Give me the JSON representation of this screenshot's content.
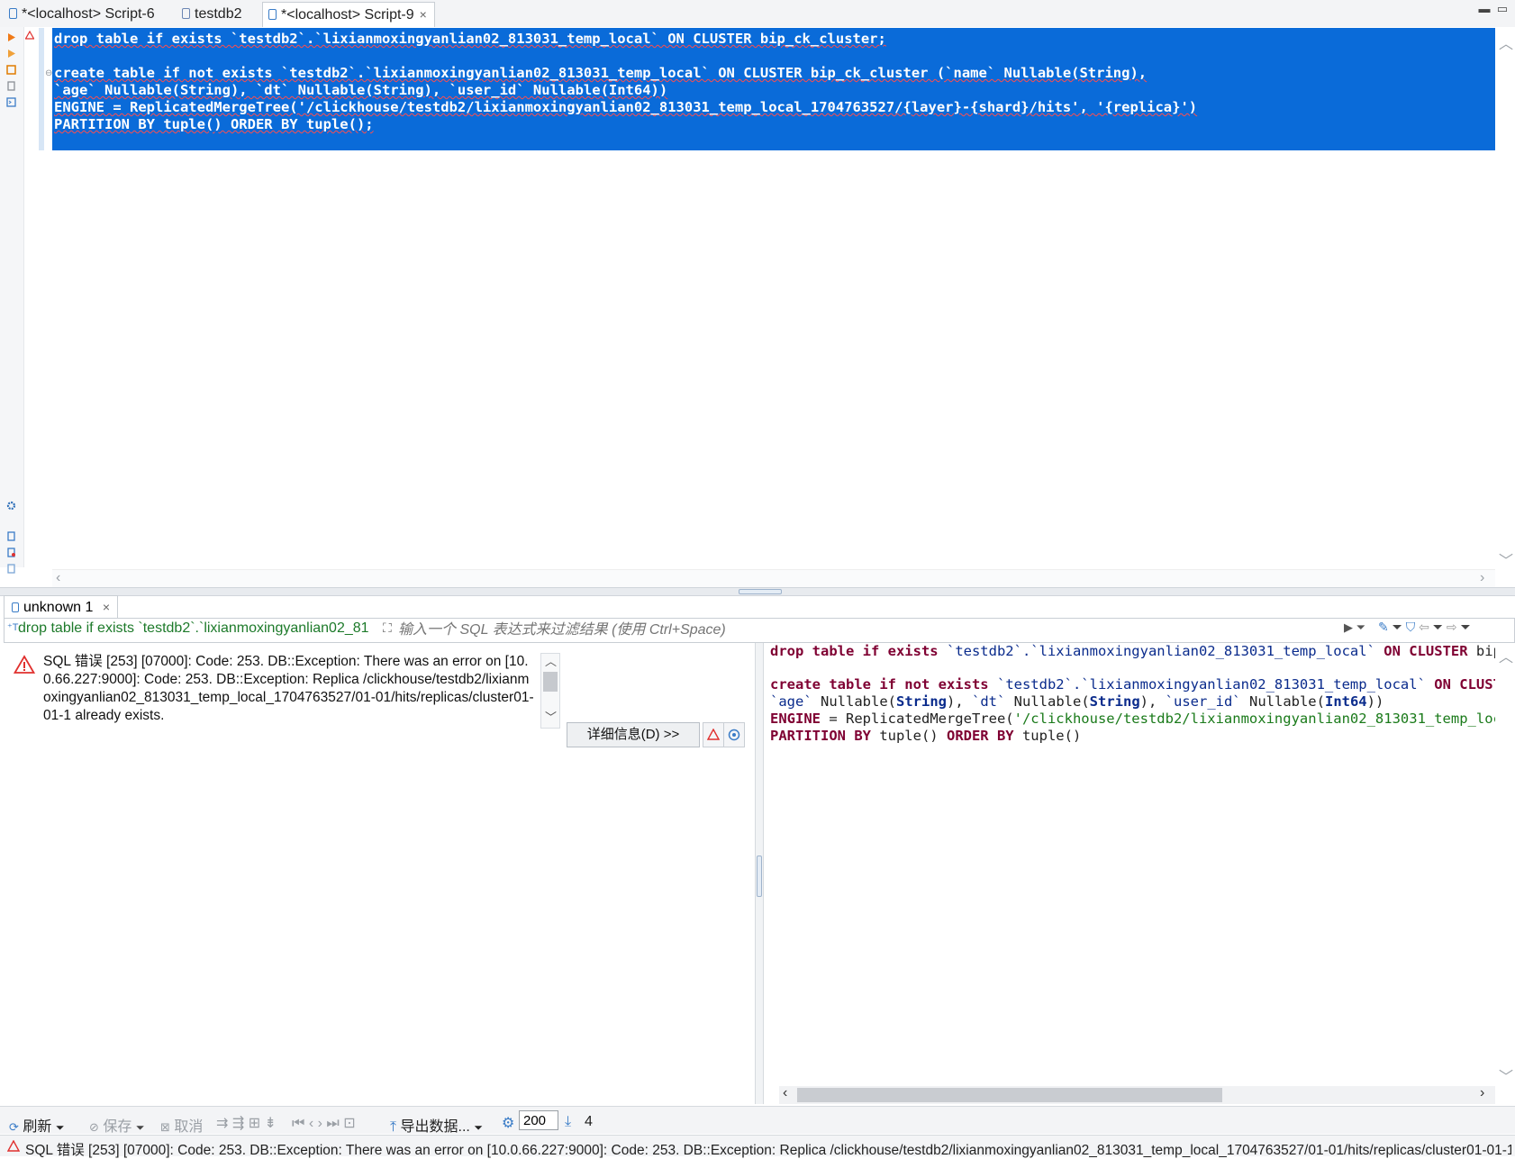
{
  "tabs": [
    {
      "label": "*<localhost> Script-6"
    },
    {
      "label": "testdb2"
    },
    {
      "label": "*<localhost> Script-9",
      "close": "×"
    }
  ],
  "editor": {
    "line1": "drop table if exists `testdb2`.`lixianmoxingyanlian02_813031_temp_local` ON CLUSTER bip_ck_cluster;",
    "line3": "create table if not exists `testdb2`.`lixianmoxingyanlian02_813031_temp_local` ON CLUSTER bip_ck_cluster (`name` Nullable(String),",
    "line4": "`age` Nullable(String), `dt` Nullable(String), `user_id` Nullable(Int64))",
    "line5": "ENGINE = ReplicatedMergeTree('/clickhouse/testdb2/lixianmoxingyanlian02_813031_temp_local_1704763527/{layer}-{shard}/hits', '{replica}')",
    "line6": "PARTITION BY tuple() ORDER BY tuple();"
  },
  "results": {
    "tab_label": "unknown 1",
    "tab_close": "×",
    "query_crumb": "drop table if exists `testdb2`.`lixianmoxingyanlian02_81",
    "filter_placeholder": "输入一个 SQL 表达式来过滤结果 (使用 Ctrl+Space)",
    "error_message": "SQL 错误 [253] [07000]: Code: 253. DB::Exception: There was an error on [10.0.66.227:9000]: Code: 253. DB::Exception: Replica /clickhouse/testdb2/lixianmoxingyanlian02_813031_temp_local_1704763527/01-01/hits/replicas/cluster01-01-1 already exists.",
    "details_button": "详细信息(D) >>"
  },
  "toolbar": {
    "refresh": "刷新",
    "save": "保存",
    "cancel": "取消",
    "export": "导出数据...",
    "limit": "200",
    "count": "4"
  },
  "status": {
    "text": "SQL 错误 [253] [07000]: Code: 253. DB::Exception: There was an error on [10.0.66.227:9000]: Code: 253. DB::Exception: Replica /clickhouse/testdb2/lixianmoxingyanlian02_813031_temp_local_1704763527/01-01/hits/replicas/cluster01-01-1 already exist"
  },
  "colors": {
    "selection": "#0a6bd9",
    "keyword": "#7f0032",
    "string": "#1a7a1a",
    "error": "#e0302e"
  },
  "icons": [
    "script-icon",
    "run-icon",
    "warning-icon",
    "gear-icon",
    "filter-icon",
    "export-icon"
  ]
}
